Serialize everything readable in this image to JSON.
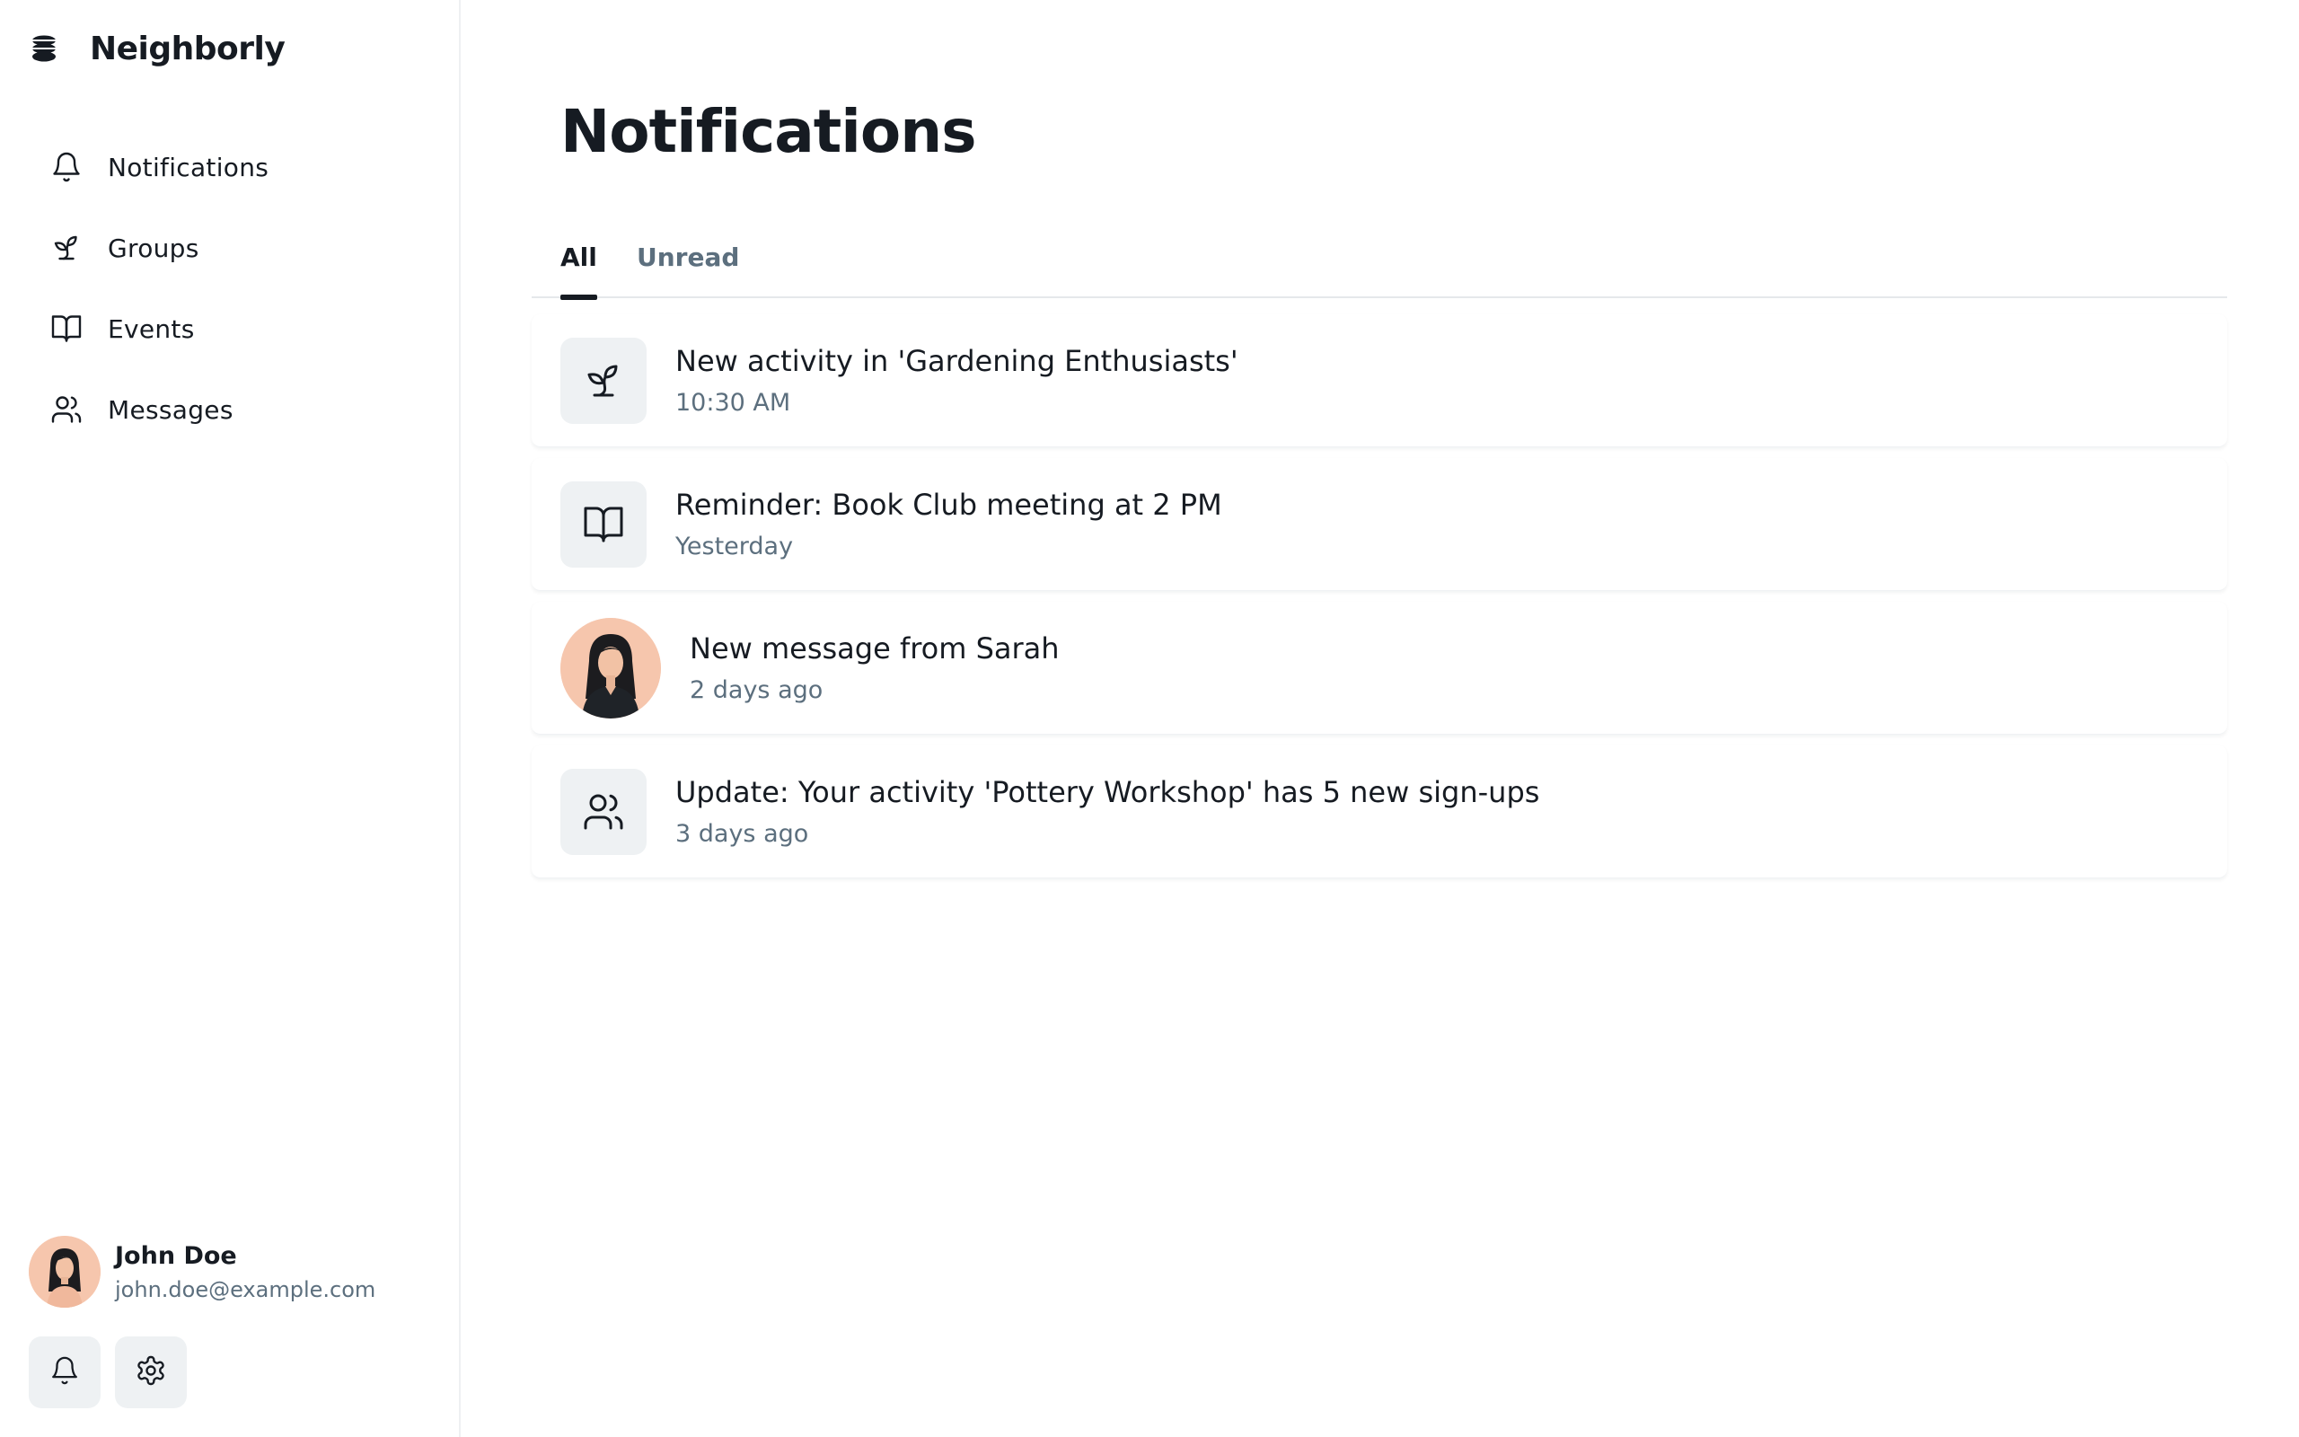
{
  "brand": {
    "name": "Neighborly",
    "logo_icon": "stack-logo-icon"
  },
  "sidebar": {
    "items": [
      {
        "label": "Notifications",
        "icon": "bell-icon"
      },
      {
        "label": "Groups",
        "icon": "sprout-icon"
      },
      {
        "label": "Events",
        "icon": "book-open-icon"
      },
      {
        "label": "Messages",
        "icon": "users-icon"
      }
    ]
  },
  "user": {
    "name": "John Doe",
    "email": "john.doe@example.com",
    "actions": [
      "bell-icon",
      "gear-icon"
    ]
  },
  "main": {
    "title": "Notifications",
    "tabs": [
      {
        "label": "All",
        "active": true
      },
      {
        "label": "Unread",
        "active": false
      }
    ],
    "notifications": [
      {
        "title": "New activity in 'Gardening Enthusiasts'",
        "time": "10:30 AM",
        "icon": "sprout-icon"
      },
      {
        "title": "Reminder: Book Club meeting at 2 PM",
        "time": "Yesterday",
        "icon": "book-open-icon"
      },
      {
        "title": "New message from Sarah",
        "time": "2 days ago",
        "icon": "avatar"
      },
      {
        "title": "Update: Your activity 'Pottery Workshop' has 5 new sign-ups",
        "time": "3 days ago",
        "icon": "users-icon"
      }
    ]
  },
  "colors": {
    "text": "#161b22",
    "muted": "#5c6f7e",
    "icon_bg": "#eef1f3",
    "avatar_bg": "#f6c6ad"
  }
}
